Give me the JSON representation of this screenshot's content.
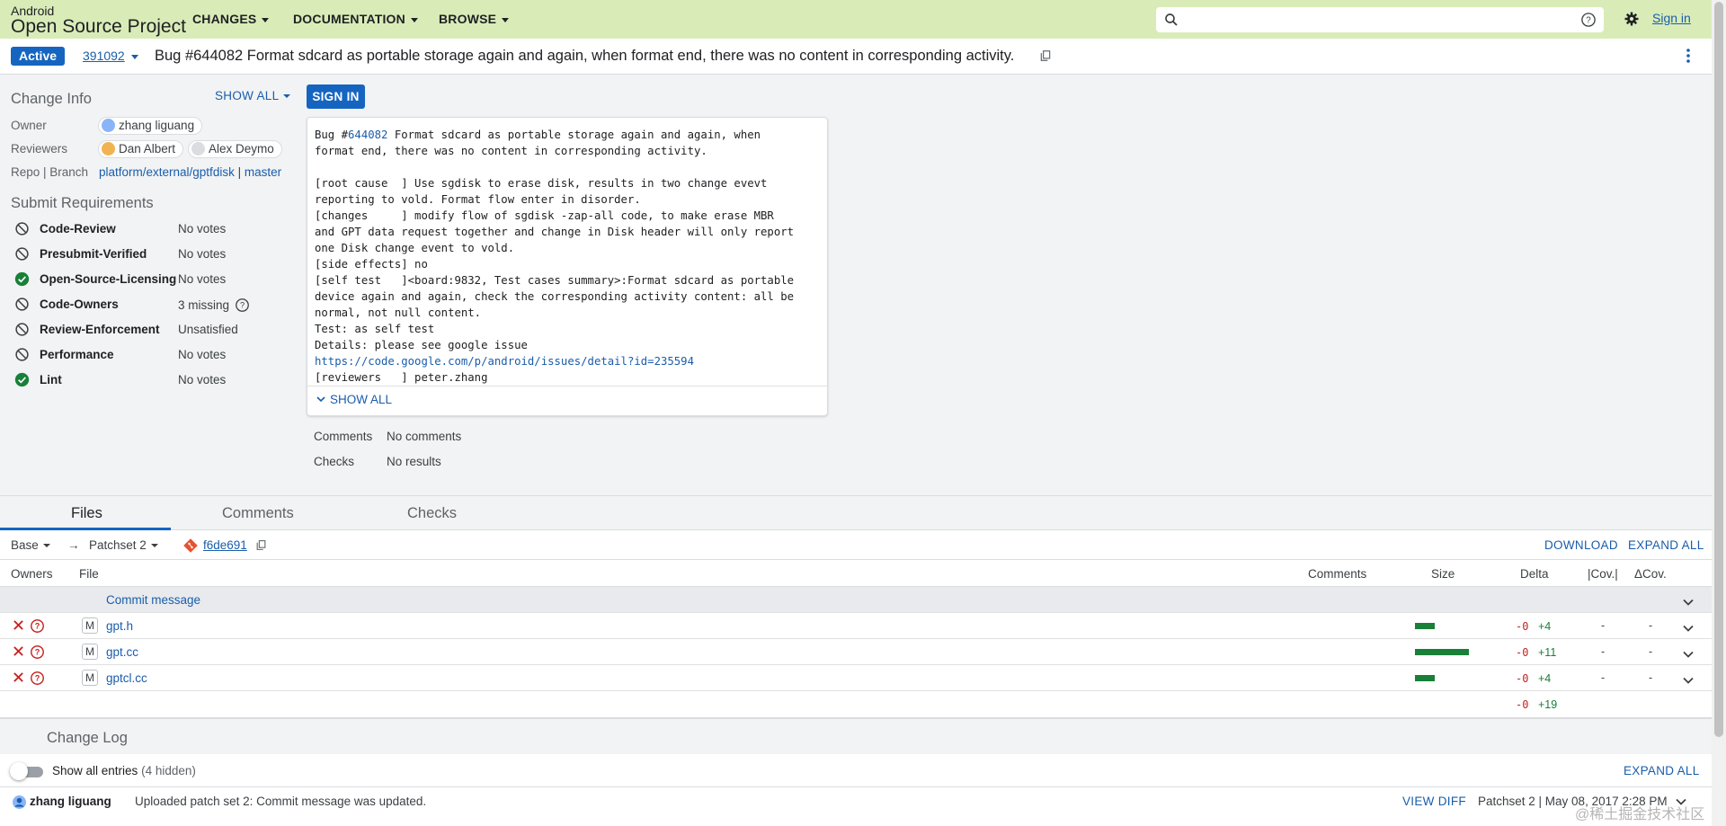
{
  "header": {
    "brand_small": "Android",
    "brand_big": "Open Source Project",
    "nav": [
      "CHANGES",
      "DOCUMENTATION",
      "BROWSE"
    ],
    "search_value": "",
    "sign_in": "Sign in"
  },
  "change": {
    "status": "Active",
    "number": "391092",
    "subject": "Bug #644082 Format sdcard as portable storage again and again, when format end, there was no content in corresponding activity."
  },
  "change_info": {
    "title": "Change Info",
    "show_all": "SHOW ALL",
    "owner_label": "Owner",
    "owner": "zhang liguang",
    "reviewers_label": "Reviewers",
    "reviewers": [
      "Dan Albert",
      "Alex Deymo"
    ],
    "repo_label": "Repo | Branch",
    "repo": "platform/external/gptfdisk",
    "separator": "|",
    "branch": "master"
  },
  "submit_requirements": {
    "title": "Submit Requirements",
    "items": [
      {
        "name": "Code-Review",
        "value": "No votes",
        "status": "blocked"
      },
      {
        "name": "Presubmit-Verified",
        "value": "No votes",
        "status": "blocked"
      },
      {
        "name": "Open-Source-Licensing",
        "value": "No votes",
        "status": "satisfied"
      },
      {
        "name": "Code-Owners",
        "value": "3 missing",
        "status": "blocked"
      },
      {
        "name": "Review-Enforcement",
        "value": "Unsatisfied",
        "status": "blocked"
      },
      {
        "name": "Performance",
        "value": "No votes",
        "status": "blocked"
      },
      {
        "name": "Lint",
        "value": "No votes",
        "status": "satisfied"
      }
    ]
  },
  "sign_in_button": "SIGN IN",
  "commit_message": {
    "prefix": "Bug #",
    "bug_link": "644082",
    "after_link": " Format sdcard as portable storage again and again, when\nformat end, there was no content in corresponding activity.\n\n[root cause  ] Use sgdisk to erase disk, results in two change evevt\nreporting to vold. Format flow enter in disorder.\n[changes     ] modify flow of sgdisk -zap-all code, to make erase MBR\nand GPT data request together and change in Disk header will only report\none Disk change event to vold.\n[side effects] no\n[self test   ]<board:9832, Test cases summary>:Format sdcard as portable\ndevice again and again, check the corresponding activity content: all be\nnormal, not null content.\nTest: as self test\nDetails: please see google issue\n",
    "url": "https://code.google.com/p/android/issues/detail?id=235594",
    "tail": "\n[reviewers   ] peter.zhang",
    "show_all": "SHOW ALL"
  },
  "meta": {
    "comments_label": "Comments",
    "comments_value": "No comments",
    "checks_label": "Checks",
    "checks_value": "No results"
  },
  "tabs": [
    "Files",
    "Comments",
    "Checks"
  ],
  "files_toolbar": {
    "base": "Base",
    "arrow": "→",
    "patchset": "Patchset 2",
    "commit": "f6de691",
    "download": "DOWNLOAD",
    "expand_all": "EXPAND ALL"
  },
  "file_columns": {
    "owners": "Owners",
    "file": "File",
    "comments": "Comments",
    "size": "Size",
    "delta": "Delta",
    "cov": "|Cov.|",
    "dcov": "ΔCov."
  },
  "commit_row": "Commit message",
  "files": [
    {
      "status": "M",
      "name": "gpt.h",
      "removed": "-0",
      "added": "+4",
      "cov": "-",
      "dcov": "-",
      "size_fraction": 0.36
    },
    {
      "status": "M",
      "name": "gpt.cc",
      "removed": "-0",
      "added": "+11",
      "cov": "-",
      "dcov": "-",
      "size_fraction": 1.0
    },
    {
      "status": "M",
      "name": "gptcl.cc",
      "removed": "-0",
      "added": "+4",
      "cov": "-",
      "dcov": "-",
      "size_fraction": 0.36
    }
  ],
  "totals": {
    "removed": "-0",
    "added": "+19"
  },
  "change_log": {
    "title": "Change Log",
    "toggle_label": "Show all entries",
    "hidden": "(4 hidden)",
    "expand_all": "EXPAND ALL",
    "entry": {
      "author": "zhang liguang",
      "message": "Uploaded patch set 2: Commit message was updated.",
      "view_diff": "VIEW DIFF",
      "date": "Patchset 2 | May 08, 2017 2:28 PM"
    }
  },
  "watermark": "@稀土掘金技术社区",
  "colors": {
    "header_bg": "#d9ecb8",
    "primary": "#1565c0",
    "link": "#1a5dab",
    "added": "#188038",
    "removed": "#c5221f"
  }
}
